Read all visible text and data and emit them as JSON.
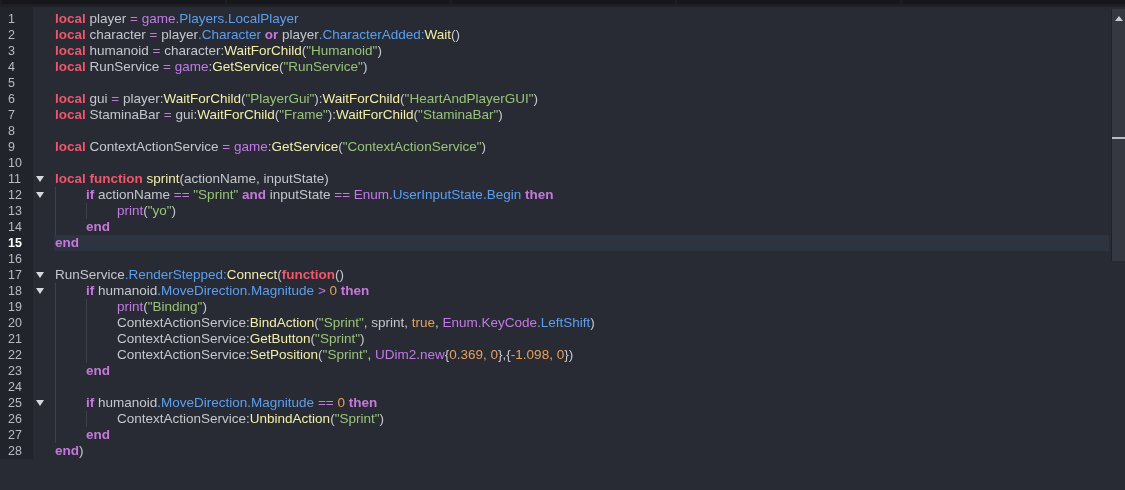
{
  "editor": {
    "lines": [
      {
        "number": "1",
        "tokens": [
          {
            "text": "local",
            "kind": "kw"
          },
          {
            "text": " player ",
            "kind": "id"
          },
          {
            "text": "= ",
            "kind": "op"
          },
          {
            "text": "game",
            "kind": "glob"
          },
          {
            "text": ".",
            "kind": "op"
          },
          {
            "text": "Players.LocalPlayer",
            "kind": "mem"
          }
        ]
      },
      {
        "number": "2",
        "tokens": [
          {
            "text": "local",
            "kind": "kw"
          },
          {
            "text": " character ",
            "kind": "id"
          },
          {
            "text": "= ",
            "kind": "op"
          },
          {
            "text": "player",
            "kind": "id"
          },
          {
            "text": ".Character ",
            "kind": "mem"
          },
          {
            "text": "or",
            "kind": "ctl"
          },
          {
            "text": " player",
            "kind": "id"
          },
          {
            "text": ".CharacterAdded:",
            "kind": "mem"
          },
          {
            "text": "Wait",
            "kind": "call"
          },
          {
            "text": "()",
            "kind": "id"
          }
        ]
      },
      {
        "number": "3",
        "tokens": [
          {
            "text": "local",
            "kind": "kw"
          },
          {
            "text": " humanoid ",
            "kind": "id"
          },
          {
            "text": "= ",
            "kind": "op"
          },
          {
            "text": "character:",
            "kind": "id"
          },
          {
            "text": "WaitForChild",
            "kind": "call"
          },
          {
            "text": "(",
            "kind": "id"
          },
          {
            "text": "\"Humanoid\"",
            "kind": "str"
          },
          {
            "text": ")",
            "kind": "id"
          }
        ]
      },
      {
        "number": "4",
        "tokens": [
          {
            "text": "local",
            "kind": "kw"
          },
          {
            "text": " RunService ",
            "kind": "id"
          },
          {
            "text": "= ",
            "kind": "op"
          },
          {
            "text": "game",
            "kind": "glob"
          },
          {
            "text": ":",
            "kind": "id"
          },
          {
            "text": "GetService",
            "kind": "call"
          },
          {
            "text": "(",
            "kind": "id"
          },
          {
            "text": "\"RunService\"",
            "kind": "str"
          },
          {
            "text": ")",
            "kind": "id"
          }
        ]
      },
      {
        "number": "5"
      },
      {
        "number": "6",
        "tokens": [
          {
            "text": "local",
            "kind": "kw"
          },
          {
            "text": " gui ",
            "kind": "id"
          },
          {
            "text": "= ",
            "kind": "op"
          },
          {
            "text": "player:",
            "kind": "id"
          },
          {
            "text": "WaitForChild",
            "kind": "call"
          },
          {
            "text": "(",
            "kind": "id"
          },
          {
            "text": "\"PlayerGui\"",
            "kind": "str"
          },
          {
            "text": "):",
            "kind": "id"
          },
          {
            "text": "WaitForChild",
            "kind": "call"
          },
          {
            "text": "(",
            "kind": "id"
          },
          {
            "text": "\"HeartAndPlayerGUI\"",
            "kind": "str"
          },
          {
            "text": ")",
            "kind": "id"
          }
        ]
      },
      {
        "number": "7",
        "tokens": [
          {
            "text": "local",
            "kind": "kw"
          },
          {
            "text": " StaminaBar ",
            "kind": "id"
          },
          {
            "text": "= ",
            "kind": "op"
          },
          {
            "text": "gui:",
            "kind": "id"
          },
          {
            "text": "WaitForChild",
            "kind": "call"
          },
          {
            "text": "(",
            "kind": "id"
          },
          {
            "text": "\"Frame\"",
            "kind": "str"
          },
          {
            "text": "):",
            "kind": "id"
          },
          {
            "text": "WaitForChild",
            "kind": "call"
          },
          {
            "text": "(",
            "kind": "id"
          },
          {
            "text": "\"StaminaBar\"",
            "kind": "str"
          },
          {
            "text": ")",
            "kind": "id"
          }
        ]
      },
      {
        "number": "8"
      },
      {
        "number": "9",
        "tokens": [
          {
            "text": "local",
            "kind": "kw"
          },
          {
            "text": " ContextActionService ",
            "kind": "id"
          },
          {
            "text": "= ",
            "kind": "op"
          },
          {
            "text": "game",
            "kind": "glob"
          },
          {
            "text": ":",
            "kind": "id"
          },
          {
            "text": "GetService",
            "kind": "call"
          },
          {
            "text": "(",
            "kind": "id"
          },
          {
            "text": "\"ContextActionService\"",
            "kind": "str"
          },
          {
            "text": ")",
            "kind": "id"
          }
        ]
      },
      {
        "number": "10"
      },
      {
        "number": "11",
        "expanded": true,
        "tokens": [
          {
            "text": "local function ",
            "kind": "kw"
          },
          {
            "text": "sprint",
            "kind": "call"
          },
          {
            "text": "(actionName, inputState)",
            "kind": "id"
          }
        ],
        "children": [
          {
            "number": "12",
            "expanded": true,
            "tokens": [
              {
                "text": "if",
                "kind": "ctl"
              },
              {
                "text": " actionName ",
                "kind": "id"
              },
              {
                "text": "== ",
                "kind": "op"
              },
              {
                "text": "\"Sprint\"",
                "kind": "str"
              },
              {
                "text": " and",
                "kind": "ctl"
              },
              {
                "text": " inputState ",
                "kind": "id"
              },
              {
                "text": "== ",
                "kind": "op"
              },
              {
                "text": "Enum.",
                "kind": "glob"
              },
              {
                "text": "UserInputState.Begin ",
                "kind": "mem"
              },
              {
                "text": "then",
                "kind": "ctl"
              }
            ],
            "children": [
              {
                "number": "13",
                "tokens": [
                  {
                    "text": "print",
                    "kind": "glob"
                  },
                  {
                    "text": "(",
                    "kind": "id"
                  },
                  {
                    "text": "\"yo\"",
                    "kind": "str"
                  },
                  {
                    "text": ")",
                    "kind": "id"
                  }
                ]
              }
            ]
          },
          {
            "number": "14",
            "tokens": [
              {
                "text": "end",
                "kind": "ctl"
              }
            ]
          }
        ]
      },
      {
        "number": "15",
        "current": true,
        "tokens": [
          {
            "text": "end",
            "kind": "ctl"
          }
        ]
      },
      {
        "number": "16"
      },
      {
        "number": "17",
        "expanded": true,
        "tokens": [
          {
            "text": "RunService",
            "kind": "id"
          },
          {
            "text": ".RenderStepped:",
            "kind": "mem"
          },
          {
            "text": "Connect",
            "kind": "call"
          },
          {
            "text": "(",
            "kind": "id"
          },
          {
            "text": "function",
            "kind": "kw"
          },
          {
            "text": "()",
            "kind": "id"
          }
        ],
        "children": [
          {
            "number": "18",
            "expanded": true,
            "tokens": [
              {
                "text": "if",
                "kind": "ctl"
              },
              {
                "text": " humanoid",
                "kind": "id"
              },
              {
                "text": ".MoveDirection.Magnitude ",
                "kind": "mem"
              },
              {
                "text": "> ",
                "kind": "op"
              },
              {
                "text": "0 ",
                "kind": "num"
              },
              {
                "text": "then",
                "kind": "ctl"
              }
            ],
            "children": [
              {
                "number": "19",
                "tokens": [
                  {
                    "text": "print",
                    "kind": "glob"
                  },
                  {
                    "text": "(",
                    "kind": "id"
                  },
                  {
                    "text": "\"Binding\"",
                    "kind": "str"
                  },
                  {
                    "text": ")",
                    "kind": "id"
                  }
                ]
              },
              {
                "number": "20",
                "tokens": [
                  {
                    "text": "ContextActionService:",
                    "kind": "id"
                  },
                  {
                    "text": "BindAction",
                    "kind": "call"
                  },
                  {
                    "text": "(",
                    "kind": "id"
                  },
                  {
                    "text": "\"Sprint\"",
                    "kind": "str"
                  },
                  {
                    "text": ", sprint, ",
                    "kind": "id"
                  },
                  {
                    "text": "true",
                    "kind": "num"
                  },
                  {
                    "text": ", ",
                    "kind": "id"
                  },
                  {
                    "text": "Enum.KeyCode.",
                    "kind": "glob"
                  },
                  {
                    "text": "LeftShift",
                    "kind": "mem"
                  },
                  {
                    "text": ")",
                    "kind": "id"
                  }
                ]
              },
              {
                "number": "21",
                "tokens": [
                  {
                    "text": "ContextActionService:",
                    "kind": "id"
                  },
                  {
                    "text": "GetButton",
                    "kind": "call"
                  },
                  {
                    "text": "(",
                    "kind": "id"
                  },
                  {
                    "text": "\"Sprint\"",
                    "kind": "str"
                  },
                  {
                    "text": ")",
                    "kind": "id"
                  }
                ]
              },
              {
                "number": "22",
                "tokens": [
                  {
                    "text": "ContextActionService:",
                    "kind": "id"
                  },
                  {
                    "text": "SetPosition",
                    "kind": "call"
                  },
                  {
                    "text": "(",
                    "kind": "id"
                  },
                  {
                    "text": "\"Sprint\"",
                    "kind": "str"
                  },
                  {
                    "text": ", ",
                    "kind": "id"
                  },
                  {
                    "text": "UDim2.new",
                    "kind": "glob"
                  },
                  {
                    "text": "{",
                    "kind": "id"
                  },
                  {
                    "text": "0.369, 0",
                    "kind": "num"
                  },
                  {
                    "text": "},{",
                    "kind": "id"
                  },
                  {
                    "text": "-1.098, 0",
                    "kind": "num"
                  },
                  {
                    "text": "})",
                    "kind": "id"
                  }
                ]
              }
            ]
          },
          {
            "number": "23",
            "tokens": [
              {
                "text": "end",
                "kind": "ctl"
              }
            ]
          },
          {
            "number": "24"
          },
          {
            "number": "25",
            "expanded": true,
            "tokens": [
              {
                "text": "if",
                "kind": "ctl"
              },
              {
                "text": " humanoid",
                "kind": "id"
              },
              {
                "text": ".MoveDirection.Magnitude ",
                "kind": "mem"
              },
              {
                "text": "== ",
                "kind": "op"
              },
              {
                "text": "0 ",
                "kind": "num"
              },
              {
                "text": "then",
                "kind": "ctl"
              }
            ],
            "children": [
              {
                "number": "26",
                "tokens": [
                  {
                    "text": "ContextActionService:",
                    "kind": "id"
                  },
                  {
                    "text": "UnbindAction",
                    "kind": "call"
                  },
                  {
                    "text": "(",
                    "kind": "id"
                  },
                  {
                    "text": "\"Sprint\"",
                    "kind": "str"
                  },
                  {
                    "text": ")",
                    "kind": "id"
                  }
                ]
              }
            ]
          },
          {
            "number": "27",
            "tokens": [
              {
                "text": "end",
                "kind": "ctl"
              }
            ]
          }
        ]
      },
      {
        "number": "28",
        "tokens": [
          {
            "text": "end",
            "kind": "ctl"
          },
          {
            "text": ")",
            "kind": "id"
          }
        ]
      }
    ]
  }
}
